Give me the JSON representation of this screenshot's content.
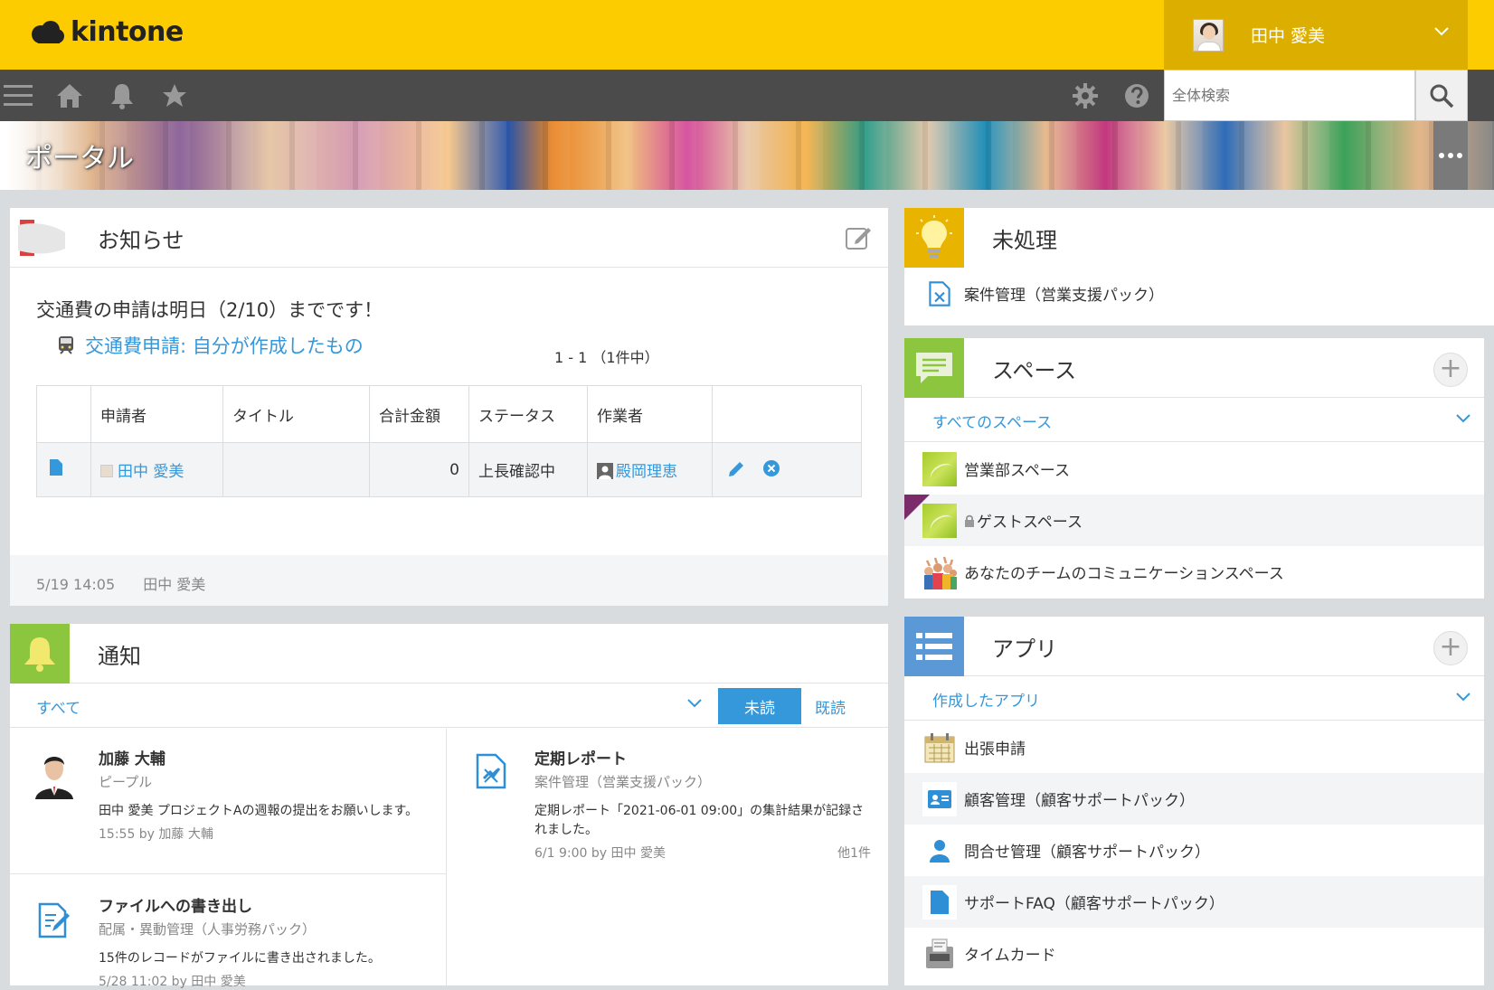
{
  "header": {
    "logo": "kintone",
    "user_name": "田中 愛美"
  },
  "nav": {
    "search_placeholder": "全体検索"
  },
  "banner": {
    "title": "ポータル"
  },
  "notice": {
    "title": "お知らせ",
    "message": "交通費の申請は明日（2/10）までです！",
    "link": "交通費申請: 自分が作成したもの",
    "pager": "1 - 1 （1件中）",
    "columns": [
      "申請者",
      "タイトル",
      "合計金額",
      "ステータス",
      "作業者"
    ],
    "row": {
      "applicant": "田中 愛美",
      "title": "",
      "amount": "0",
      "status": "上長確認中",
      "worker": "殿岡理恵"
    },
    "footer_time": "5/19 14:05",
    "footer_user": "田中 愛美"
  },
  "notifications": {
    "title": "通知",
    "filter": "すべて",
    "unread": "未読",
    "read": "既読",
    "items": [
      {
        "title": "加藤 大輔",
        "sub": "ピープル",
        "body": "田中 愛美 プロジェクトAの週報の提出をお願いします。",
        "meta": "15:55  by 加藤 大輔",
        "extra": ""
      },
      {
        "title": "定期レポート",
        "sub": "案件管理（営業支援パック）",
        "body": "定期レポート「2021-06-01 09:00」の集計結果が記録されました。",
        "meta": "6/1 9:00  by 田中 愛美",
        "extra": "他1件"
      },
      {
        "title": "ファイルへの書き出し",
        "sub": "配属・異動管理（人事労務パック）",
        "body": "15件のレコードがファイルに書き出されました。",
        "meta": "5/28 11:02  by 田中 愛美",
        "extra": ""
      }
    ]
  },
  "pending": {
    "title": "未処理",
    "item": "案件管理（営業支援パック）"
  },
  "spaces": {
    "title": "スペース",
    "filter": "すべてのスペース",
    "items": [
      "営業部スペース",
      "ゲストスペース",
      "あなたのチームのコミュニケーションスペース"
    ]
  },
  "apps": {
    "title": "アプリ",
    "filter": "作成したアプリ",
    "items": [
      "出張申請",
      "顧客管理（顧客サポートパック）",
      "問合せ管理（顧客サポートパック）",
      "サポートFAQ（顧客サポートパック）",
      "タイムカード"
    ]
  },
  "colors": {
    "header": "#fccb00",
    "nav": "#4b4b4b",
    "accent": "#3498db"
  }
}
